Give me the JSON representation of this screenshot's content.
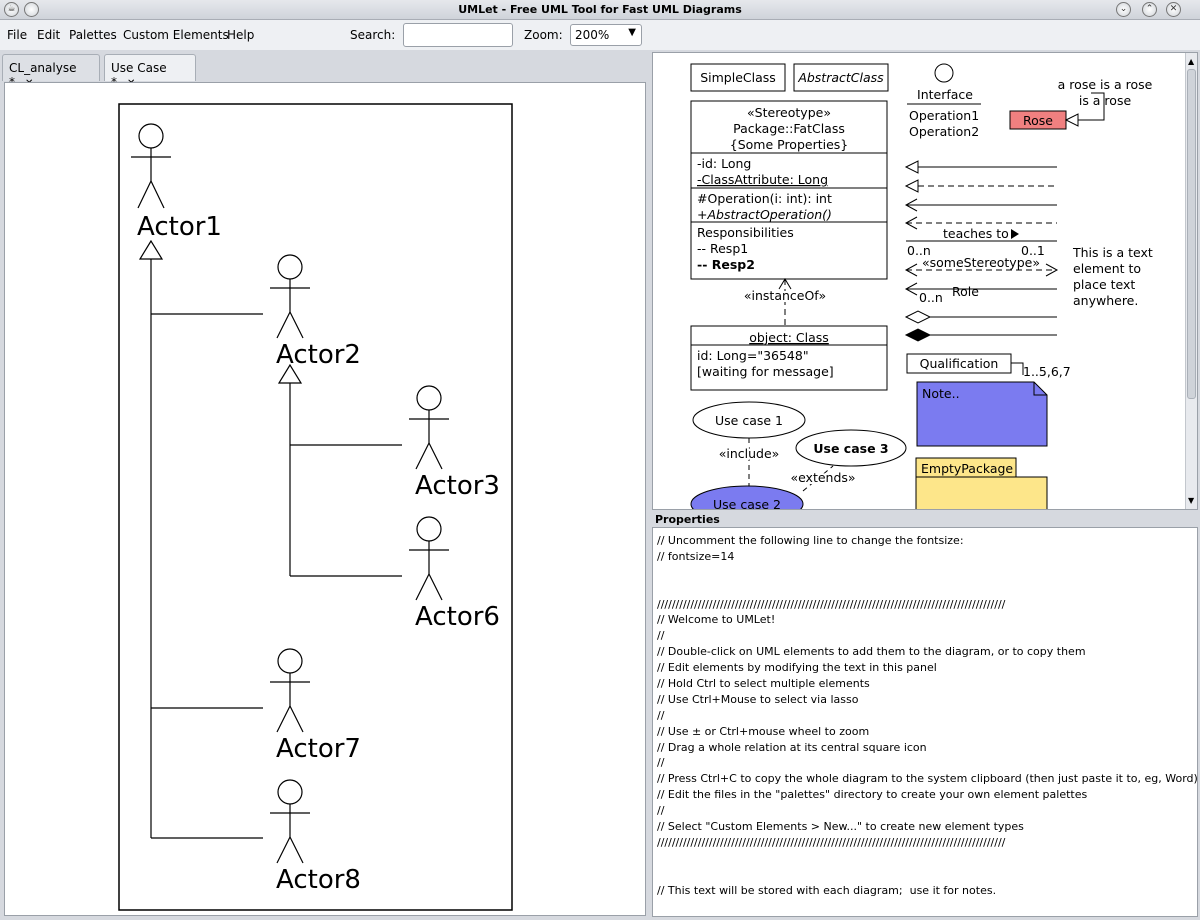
{
  "window": {
    "title": "UMLet - Free UML Tool for Fast UML Diagrams"
  },
  "menu": {
    "items": [
      "File",
      "Edit",
      "Palettes",
      "Custom Elements",
      "Help"
    ],
    "search_label": "Search:",
    "search_value": "",
    "zoom_label": "Zoom:",
    "zoom_value": "200%"
  },
  "tabs": [
    {
      "label": "CL_analyse *",
      "active": false
    },
    {
      "label": "Use Case *",
      "active": true
    }
  ],
  "diagram": {
    "actors": [
      "Actor1",
      "Actor2",
      "Actor3",
      "Actor6",
      "Actor7",
      "Actor8"
    ]
  },
  "palette": {
    "simple_class": "SimpleClass",
    "abstract_class": "AbstractClass",
    "interface_name": "Interface",
    "interface_ops": [
      "Operation1",
      "Operation2"
    ],
    "rose_note": [
      "a rose is a rose",
      "is a rose"
    ],
    "rose": "Rose",
    "fat_class_header": [
      "«Stereotype»",
      "Package::FatClass",
      "{Some Properties}"
    ],
    "fat_class_attrs": [
      "-id: Long",
      "-ClassAttribute: Long"
    ],
    "fat_class_ops": [
      "#Operation(i: int): int",
      "+AbstractOperation()"
    ],
    "fat_class_resp": [
      "Responsibilities",
      "-- Resp1",
      "-- Resp2"
    ],
    "teaches": "teaches to",
    "mult_left": "0..n",
    "mult_right": "0..1",
    "some_stereotype": "«someStereotype»",
    "role_mult": "0..n",
    "role": "Role",
    "text_element": [
      "This is a text",
      "element to",
      "place text",
      "anywhere."
    ],
    "instance_of": "«instanceOf»",
    "object_name": "object: Class",
    "object_attrs": [
      "id: Long=\"36548\"",
      "[waiting for message]"
    ],
    "qualification": "Qualification",
    "qualification_mult": "1..5,6,7",
    "note": "Note..",
    "use_case1": "Use case 1",
    "use_case2": "Use case 2",
    "use_case3": "Use case 3",
    "include": "«include»",
    "extends": "«extends»",
    "empty_package": "EmptyPackage",
    "colors": {
      "rose": "#f08080",
      "note": "#7b7bf0",
      "package": "#fde68a",
      "use_case2": "#7b7bf0"
    }
  },
  "properties": {
    "label": "Properties",
    "lines": [
      "// Uncomment the following line to change the fontsize:",
      "// fontsize=14",
      "",
      "",
      "//////////////////////////////////////////////////////////////////////////////////////////////",
      "// Welcome to UMLet!",
      "//",
      "// Double-click on UML elements to add them to the diagram, or to copy them",
      "// Edit elements by modifying the text in this panel",
      "// Hold Ctrl to select multiple elements",
      "// Use Ctrl+Mouse to select via lasso",
      "//",
      "// Use ± or Ctrl+mouse wheel to zoom",
      "// Drag a whole relation at its central square icon",
      "//",
      "// Press Ctrl+C to copy the whole diagram to the system clipboard (then just paste it to, eg, Word)",
      "// Edit the files in the \"palettes\" directory to create your own element palettes",
      "//",
      "// Select \"Custom Elements > New...\" to create new element types",
      "//////////////////////////////////////////////////////////////////////////////////////////////",
      "",
      "",
      "// This text will be stored with each diagram;  use it for notes."
    ]
  }
}
